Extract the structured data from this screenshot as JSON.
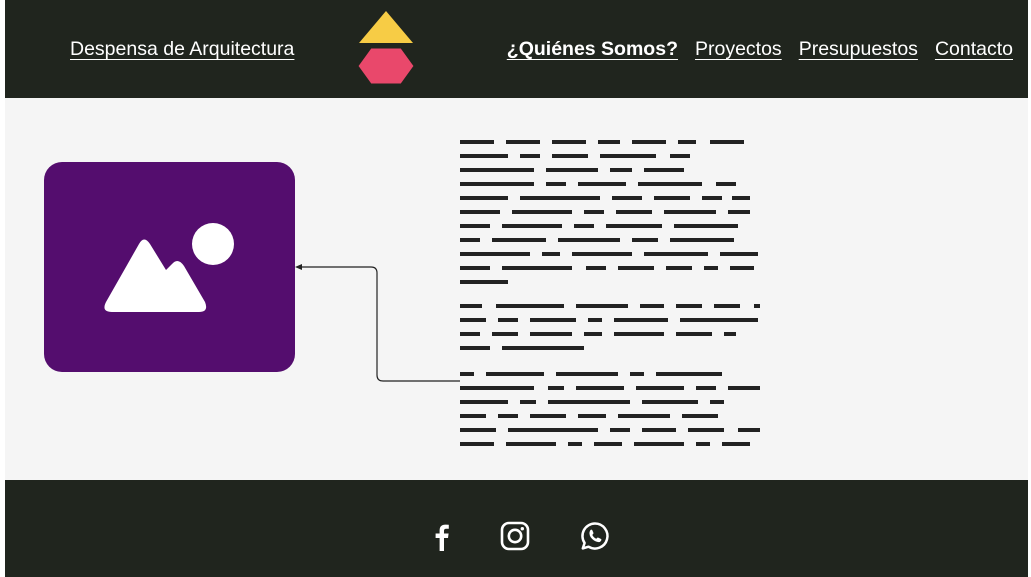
{
  "header": {
    "brand": "Despensa de Arquitectura",
    "nav": [
      {
        "label": "¿Quiénes Somos?",
        "active": true
      },
      {
        "label": "Proyectos",
        "active": false
      },
      {
        "label": "Presupuestos",
        "active": false
      },
      {
        "label": "Contacto",
        "active": false
      }
    ]
  },
  "main": {
    "image_placeholder_icon": "image-icon",
    "text_placeholder": "redacted-text-lines"
  },
  "footer": {
    "social": [
      "facebook-icon",
      "instagram-icon",
      "whatsapp-icon"
    ]
  },
  "colors": {
    "dark": "#20251e",
    "background": "#f5f5f5",
    "logo_triangle": "#f7cc45",
    "logo_hexagon": "#e9486b",
    "image_box": "#540d6e"
  }
}
